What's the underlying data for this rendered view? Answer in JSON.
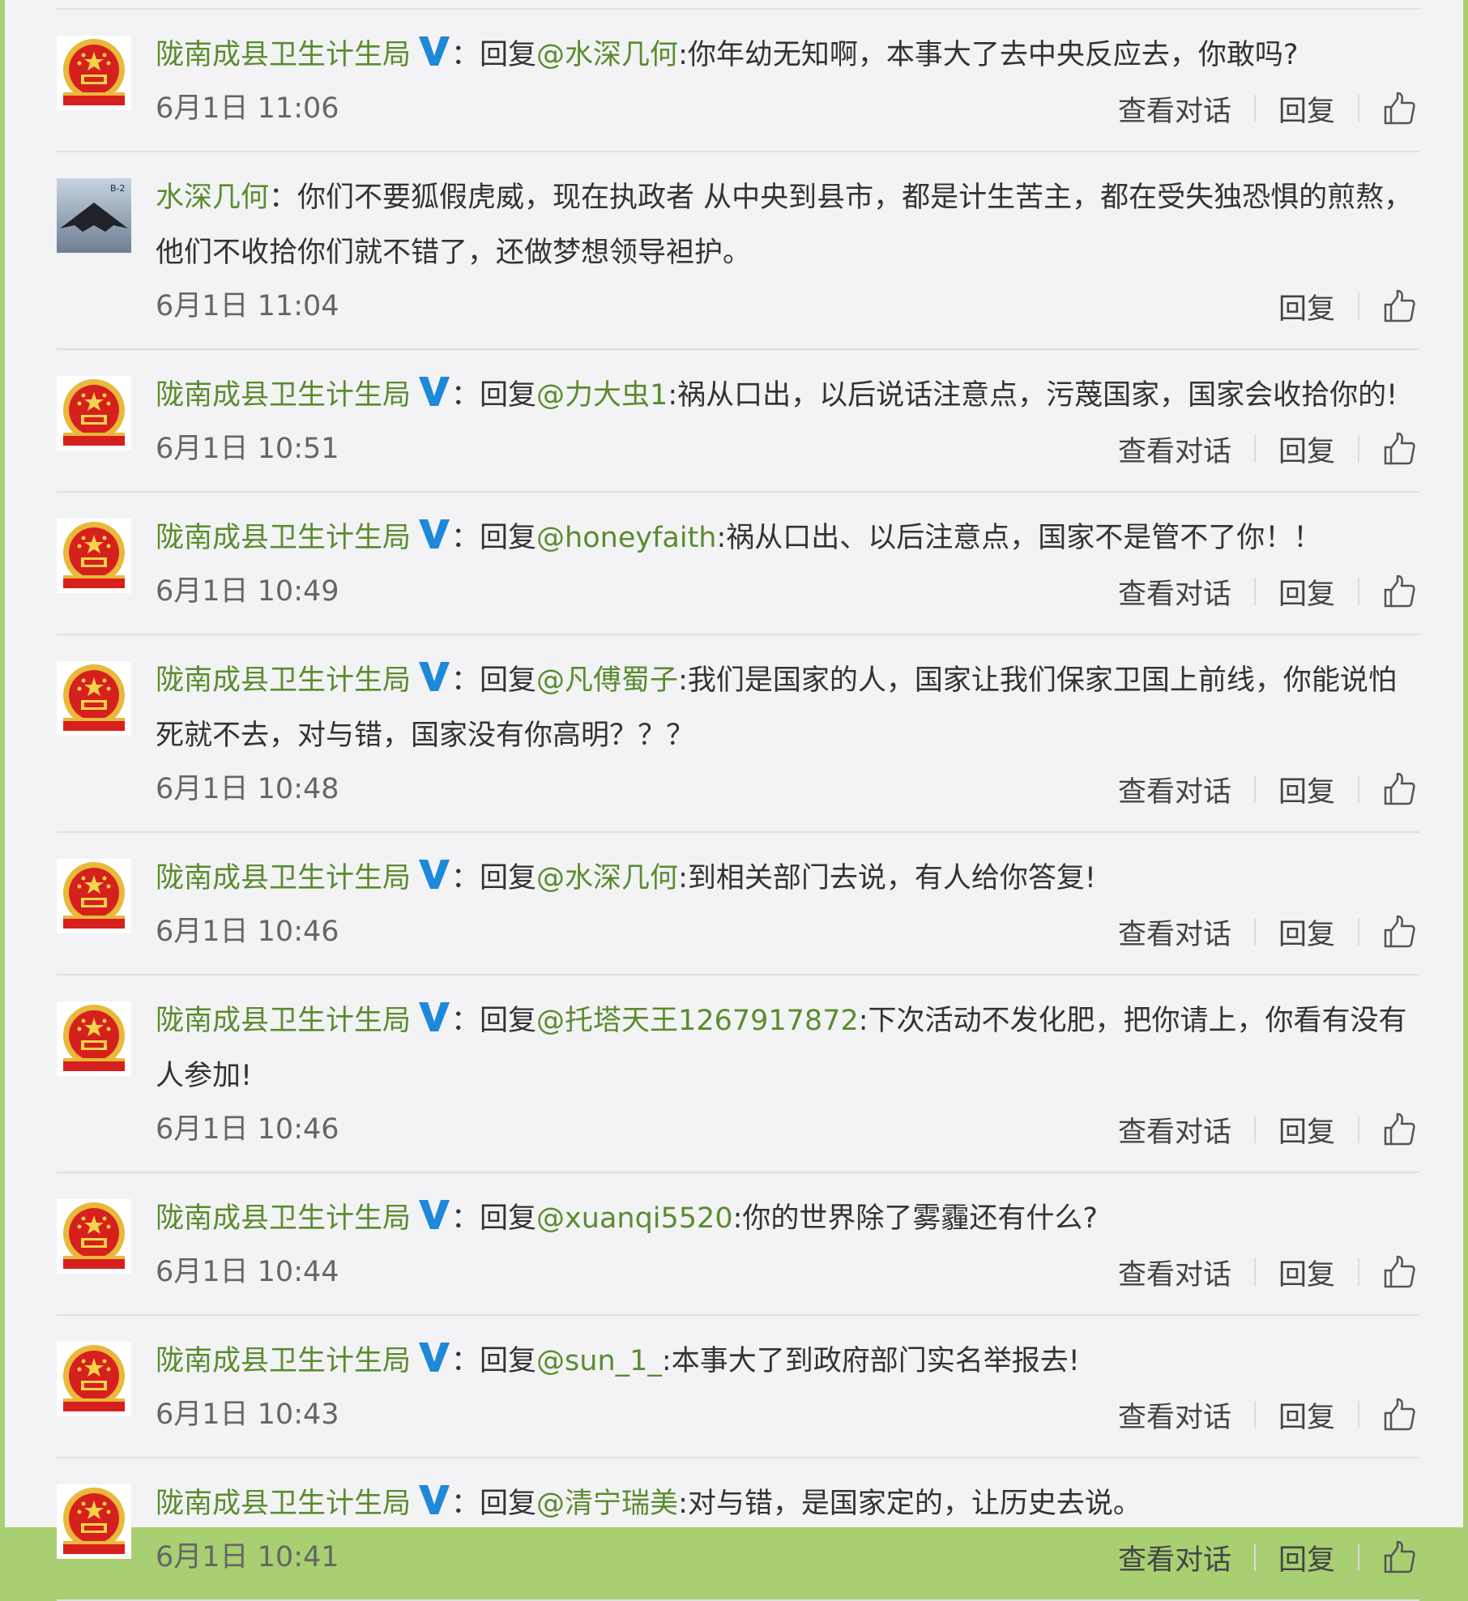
{
  "colors": {
    "page_border": "#a8cf72",
    "background": "#f3f3f6",
    "link_green": "#5b8c2e",
    "verified_blue": "#1e88d9"
  },
  "labels": {
    "view_conversation": "查看对话",
    "reply": "回复",
    "colon": "："
  },
  "comments": [
    {
      "author": "陇南成县卫生计生局",
      "verified": true,
      "avatar": "national-emblem-icon",
      "reply_prefix": "回复",
      "mention": "@水深几何",
      "text": ":你年幼无知啊，本事大了去中央反应去，你敢吗?",
      "time": "6月1日 11:06",
      "show_view_conversation": true
    },
    {
      "author": "水深几何",
      "verified": false,
      "avatar": "stealth-bomber-avatar",
      "reply_prefix": "",
      "mention": "",
      "text": "你们不要狐假虎威，现在执政者 从中央到县市，都是计生苦主，都在受失独恐惧的煎熬，他们不收拾你们就不错了，还做梦想领导袒护。",
      "time": "6月1日 11:04",
      "show_view_conversation": false
    },
    {
      "author": "陇南成县卫生计生局",
      "verified": true,
      "avatar": "national-emblem-icon",
      "reply_prefix": "回复",
      "mention": "@力大虫1",
      "text": ":祸从口出，以后说话注意点，污蔑国家，国家会收拾你的!",
      "time": "6月1日 10:51",
      "show_view_conversation": true
    },
    {
      "author": "陇南成县卫生计生局",
      "verified": true,
      "avatar": "national-emblem-icon",
      "reply_prefix": "回复",
      "mention": "@honeyfaith",
      "text": ":祸从口出、以后注意点，国家不是管不了你！！",
      "time": "6月1日 10:49",
      "show_view_conversation": true
    },
    {
      "author": "陇南成县卫生计生局",
      "verified": true,
      "avatar": "national-emblem-icon",
      "reply_prefix": "回复",
      "mention": "@凡傅蜀子",
      "text": ":我们是国家的人，国家让我们保家卫国上前线，你能说怕死就不去，对与错，国家没有你高明？？？",
      "time": "6月1日 10:48",
      "show_view_conversation": true
    },
    {
      "author": "陇南成县卫生计生局",
      "verified": true,
      "avatar": "national-emblem-icon",
      "reply_prefix": "回复",
      "mention": "@水深几何",
      "text": ":到相关部门去说，有人给你答复!",
      "time": "6月1日 10:46",
      "show_view_conversation": true
    },
    {
      "author": "陇南成县卫生计生局",
      "verified": true,
      "avatar": "national-emblem-icon",
      "reply_prefix": "回复",
      "mention": "@托塔天王1267917872",
      "text": ":下次活动不发化肥，把你请上，你看有没有人参加!",
      "time": "6月1日 10:46",
      "show_view_conversation": true
    },
    {
      "author": "陇南成县卫生计生局",
      "verified": true,
      "avatar": "national-emblem-icon",
      "reply_prefix": "回复",
      "mention": "@xuanqi5520",
      "text": ":你的世界除了雾霾还有什么?",
      "time": "6月1日 10:44",
      "show_view_conversation": true
    },
    {
      "author": "陇南成县卫生计生局",
      "verified": true,
      "avatar": "national-emblem-icon",
      "reply_prefix": "回复",
      "mention": "@sun_1_",
      "text": ":本事大了到政府部门实名举报去!",
      "time": "6月1日 10:43",
      "show_view_conversation": true
    },
    {
      "author": "陇南成县卫生计生局",
      "verified": true,
      "avatar": "national-emblem-icon",
      "reply_prefix": "回复",
      "mention": "@清宁瑞美",
      "text": ":对与错，是国家定的，让历史去说。",
      "time": "6月1日 10:41",
      "show_view_conversation": true
    }
  ]
}
